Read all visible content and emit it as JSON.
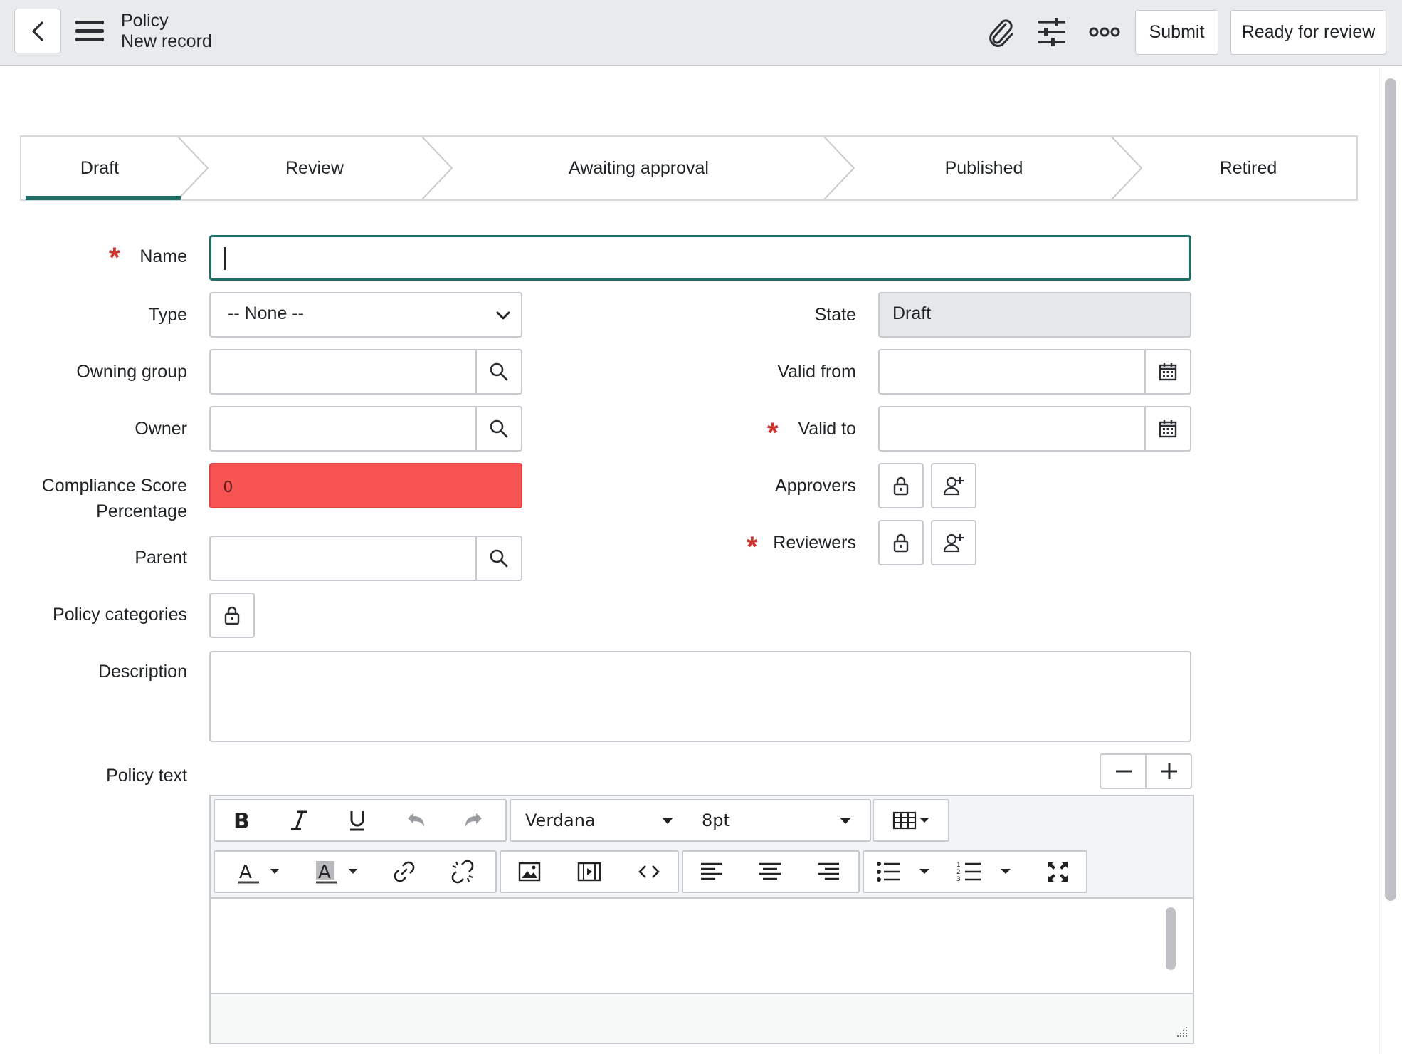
{
  "header": {
    "title": "Policy",
    "subtitle": "New record",
    "submit_label": "Submit",
    "ready_label": "Ready for review"
  },
  "stages": {
    "items": [
      "Draft",
      "Review",
      "Awaiting approval",
      "Published",
      "Retired"
    ],
    "active": "Draft",
    "accent_color": "#1d6f66"
  },
  "form": {
    "name_label": "Name",
    "name_value": "",
    "type_label": "Type",
    "type_value": "-- None --",
    "state_label": "State",
    "state_value": "Draft",
    "owning_group_label": "Owning group",
    "valid_from_label": "Valid from",
    "owner_label": "Owner",
    "valid_to_label": "Valid to",
    "compliance_label_1": "Compliance Score",
    "compliance_label_2": "Percentage",
    "compliance_value": "0",
    "compliance_color": "#f75353",
    "approvers_label": "Approvers",
    "reviewers_label": "Reviewers",
    "parent_label": "Parent",
    "policy_categories_label": "Policy categories",
    "description_label": "Description",
    "policy_text_label": "Policy text",
    "required_color": "#d0312d"
  },
  "editor": {
    "font_family": "Verdana",
    "font_size": "8pt"
  }
}
